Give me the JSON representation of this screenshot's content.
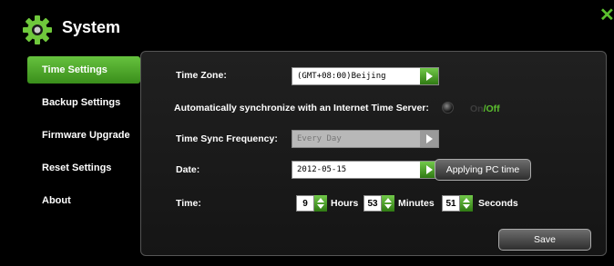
{
  "header": {
    "title": "System",
    "icon": "gear-icon",
    "close_icon": "close-icon"
  },
  "colors": {
    "accent": "#5bbf2e",
    "panel": "#1b1b1b",
    "background": "#000000"
  },
  "sidebar": {
    "items": [
      {
        "label": "Time Settings",
        "active": true
      },
      {
        "label": "Backup Settings",
        "active": false
      },
      {
        "label": "Firmware Upgrade",
        "active": false
      },
      {
        "label": "Reset Settings",
        "active": false
      },
      {
        "label": "About",
        "active": false
      }
    ]
  },
  "time_settings": {
    "time_zone": {
      "label": "Time Zone:",
      "value": "(GMT+08:00)Beijing"
    },
    "auto_sync": {
      "label": "Automatically synchronize with an Internet Time Server:",
      "on": "On",
      "separator": "/",
      "off": "Off",
      "state": "Off"
    },
    "frequency": {
      "label": "Time Sync Frequency:",
      "value": "Every Day"
    },
    "date": {
      "label": "Date:",
      "value": "2012-05-15",
      "apply_button": "Applying PC time"
    },
    "time": {
      "label": "Time:",
      "hours": "9",
      "hours_label": "Hours",
      "minutes": "53",
      "minutes_label": "Minutes",
      "seconds": "51",
      "seconds_label": "Seconds"
    },
    "save_button": "Save"
  }
}
